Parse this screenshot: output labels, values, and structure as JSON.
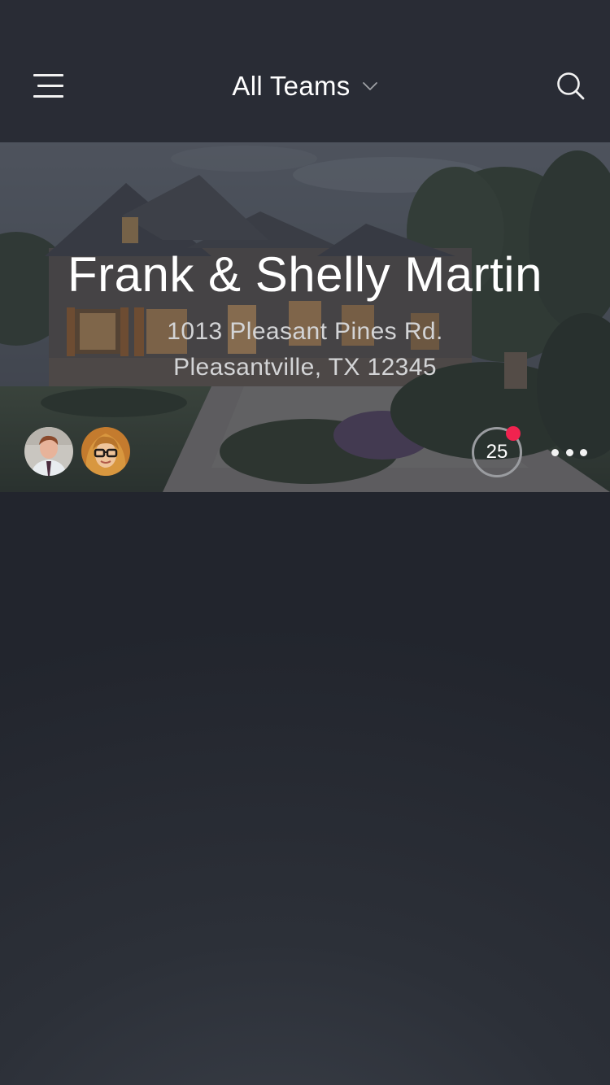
{
  "header": {
    "title": "All Teams",
    "menu_icon": "hamburger-menu-icon",
    "dropdown_icon": "chevron-down-icon",
    "search_icon": "search-icon"
  },
  "listing": {
    "client_name": "Frank & Shelly Martin",
    "address_line1": "1013 Pleasant Pines Rd.",
    "address_line2": "Pleasantville, TX 12345",
    "badge_count": "25",
    "more_icon": "more-horizontal-icon",
    "team_members": [
      {
        "avatar": "man-with-tie-avatar"
      },
      {
        "avatar": "woman-with-glasses-avatar"
      }
    ]
  },
  "colors": {
    "topbar_bg": "#292c35",
    "background": "#23262e",
    "notification_dot": "#f0234f",
    "text_primary": "#ffffff",
    "text_secondary": "#d3d4d6"
  }
}
